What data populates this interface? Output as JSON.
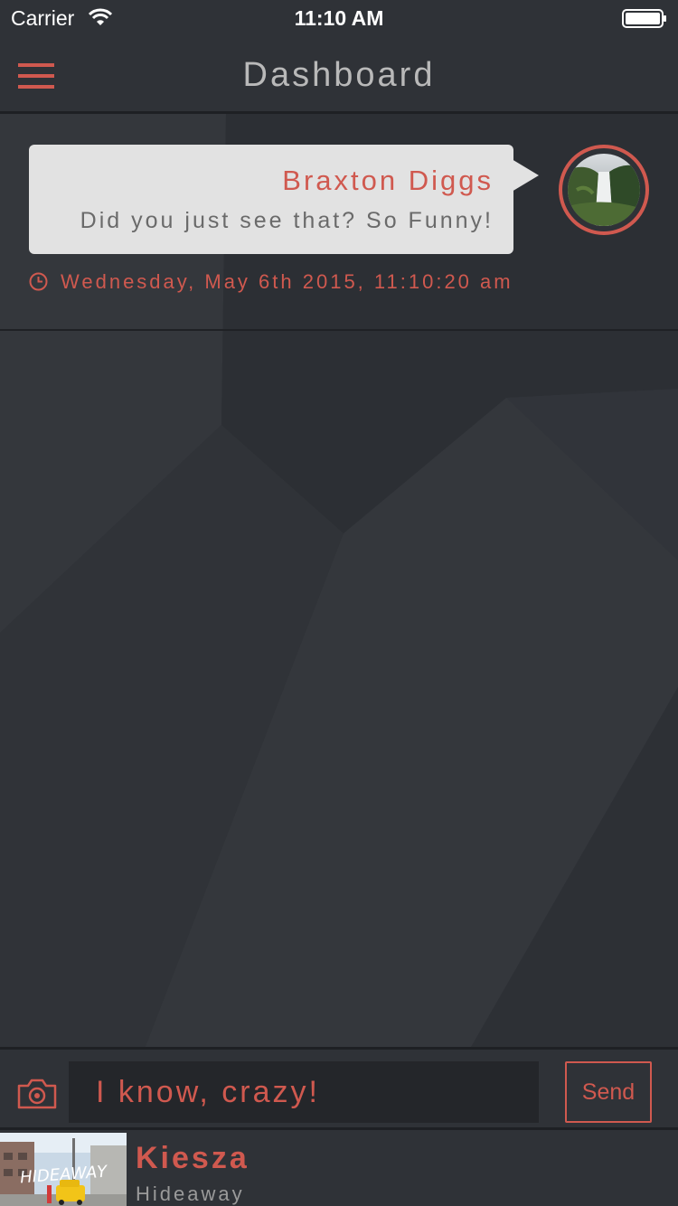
{
  "status_bar": {
    "carrier": "Carrier",
    "time": "11:10 AM"
  },
  "nav": {
    "title": "Dashboard"
  },
  "message": {
    "sender": "Braxton Diggs",
    "text": "Did you just see that? So Funny!",
    "timestamp": "Wednesday, May 6th 2015, 11:10:20 am"
  },
  "composer": {
    "value": "I know, crazy!",
    "send_label": "Send"
  },
  "now_playing": {
    "artist": "Kiesza",
    "track": "Hideaway",
    "album_text": "HIDEAWAY"
  },
  "colors": {
    "accent": "#d0594f",
    "background": "#2f3237",
    "bubble": "#e2e2e2"
  },
  "icons": {
    "menu": "hamburger-icon",
    "clock": "clock-icon",
    "camera": "camera-icon",
    "wifi": "wifi-icon",
    "battery": "battery-icon"
  }
}
